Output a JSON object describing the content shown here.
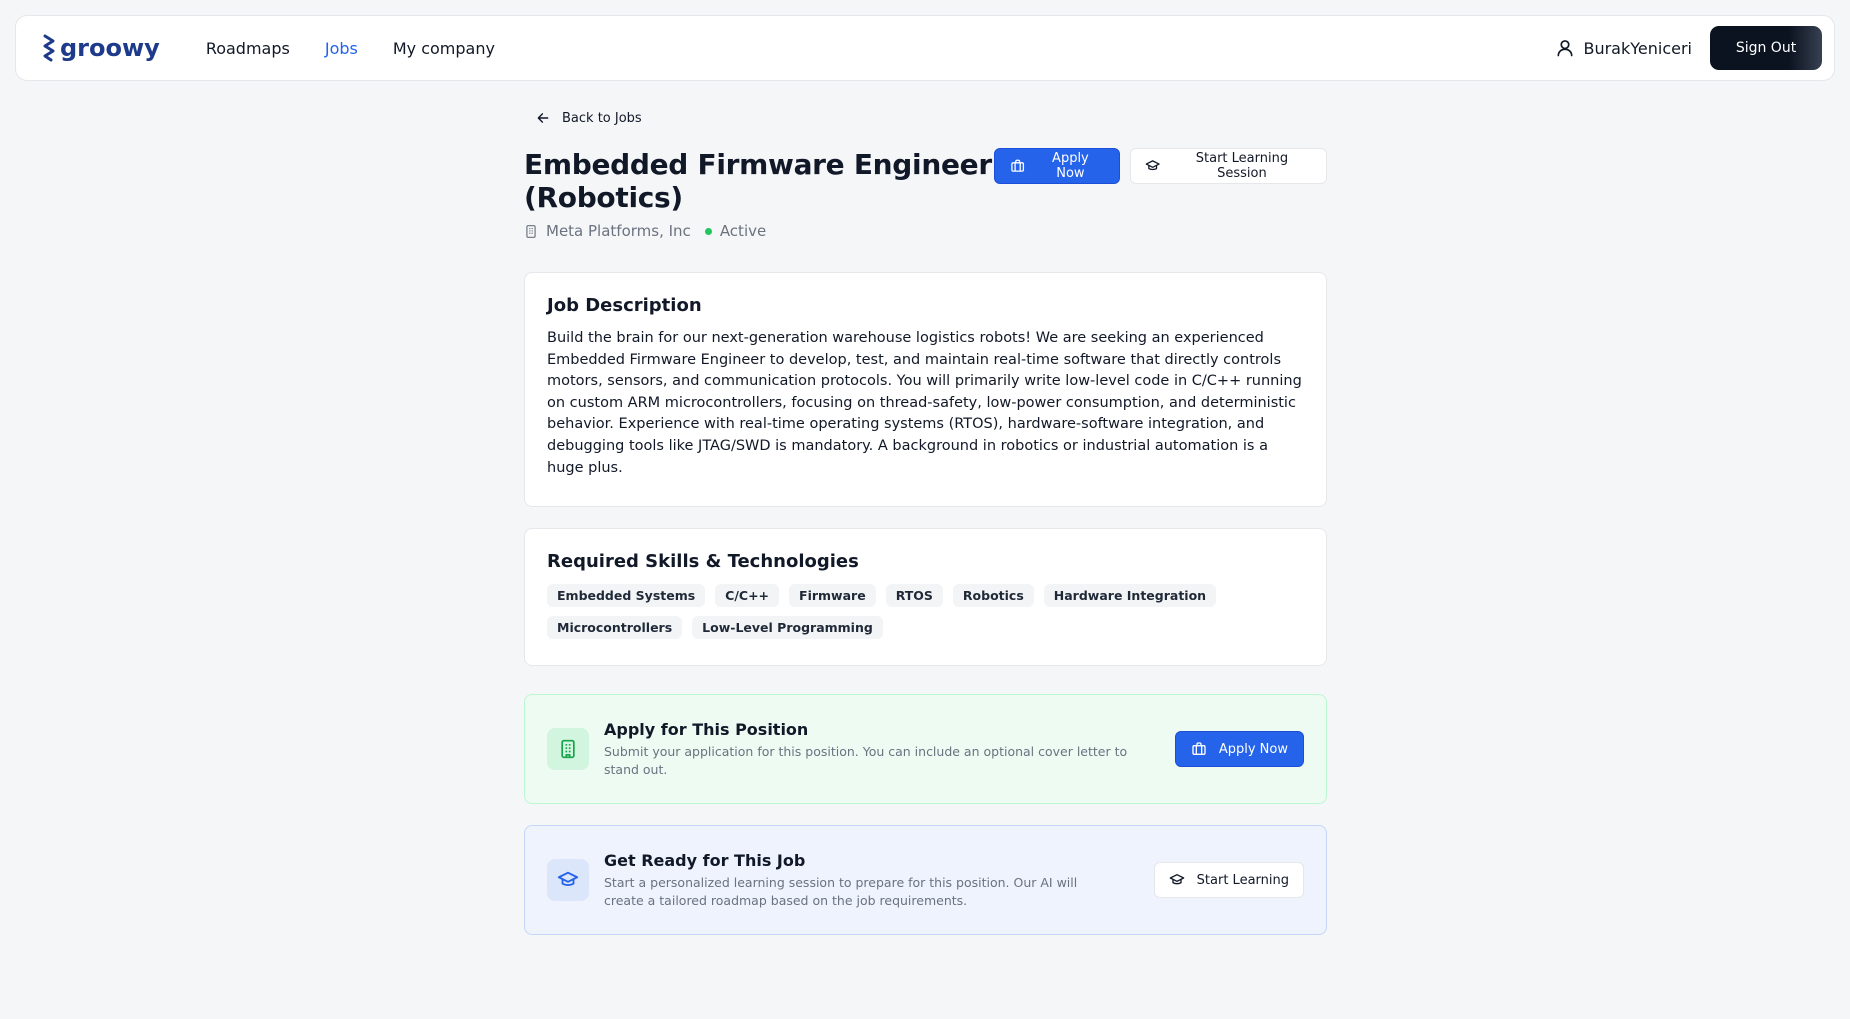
{
  "nav": {
    "brand": "groowy",
    "links": [
      "Roadmaps",
      "Jobs",
      "My company"
    ],
    "active_link": "Jobs",
    "user_name": "BurakYeniceri",
    "sign_out_label": "Sign Out"
  },
  "job": {
    "back_label": "Back to Jobs",
    "title": "Embedded Firmware Engineer (Robotics)",
    "company": "Meta Platforms, Inc",
    "status": "Active",
    "apply_label": "Apply Now",
    "learn_label": "Start Learning Session"
  },
  "description": {
    "heading": "Job Description",
    "text": "Build the brain for our next-generation warehouse logistics robots! We are seeking an experienced Embedded Firmware Engineer to develop, test, and maintain real-time software that directly controls motors, sensors, and communication protocols. You will primarily write low-level code in C/C++ running on custom ARM microcontrollers, focusing on thread-safety, low-power consumption, and deterministic behavior. Experience with real-time operating systems (RTOS), hardware-software integration, and debugging tools like JTAG/SWD is mandatory. A background in robotics or industrial automation is a huge plus."
  },
  "skills": {
    "heading": "Required Skills & Technologies",
    "items": [
      "Embedded Systems",
      "C/C++",
      "Firmware",
      "RTOS",
      "Robotics",
      "Hardware Integration",
      "Microcontrollers",
      "Low-Level Programming"
    ]
  },
  "apply_section": {
    "title": "Apply for This Position",
    "subtitle": "Submit your application for this position. You can include an optional cover letter to stand out.",
    "button": "Apply Now"
  },
  "learn_section": {
    "title": "Get Ready for This Job",
    "subtitle": "Start a personalized learning session to prepare for this position. Our AI will create a tailored roadmap based on the job requirements.",
    "button": "Start Learning"
  },
  "colors": {
    "primary": "#2563eb",
    "brand": "#1e3a8a",
    "status_active": "#22c55e",
    "signout_bg": "#0b1220"
  },
  "icons": [
    "groowy-logo-icon",
    "user-icon",
    "arrow-left-icon",
    "briefcase-icon",
    "graduation-cap-icon",
    "building-icon"
  ]
}
